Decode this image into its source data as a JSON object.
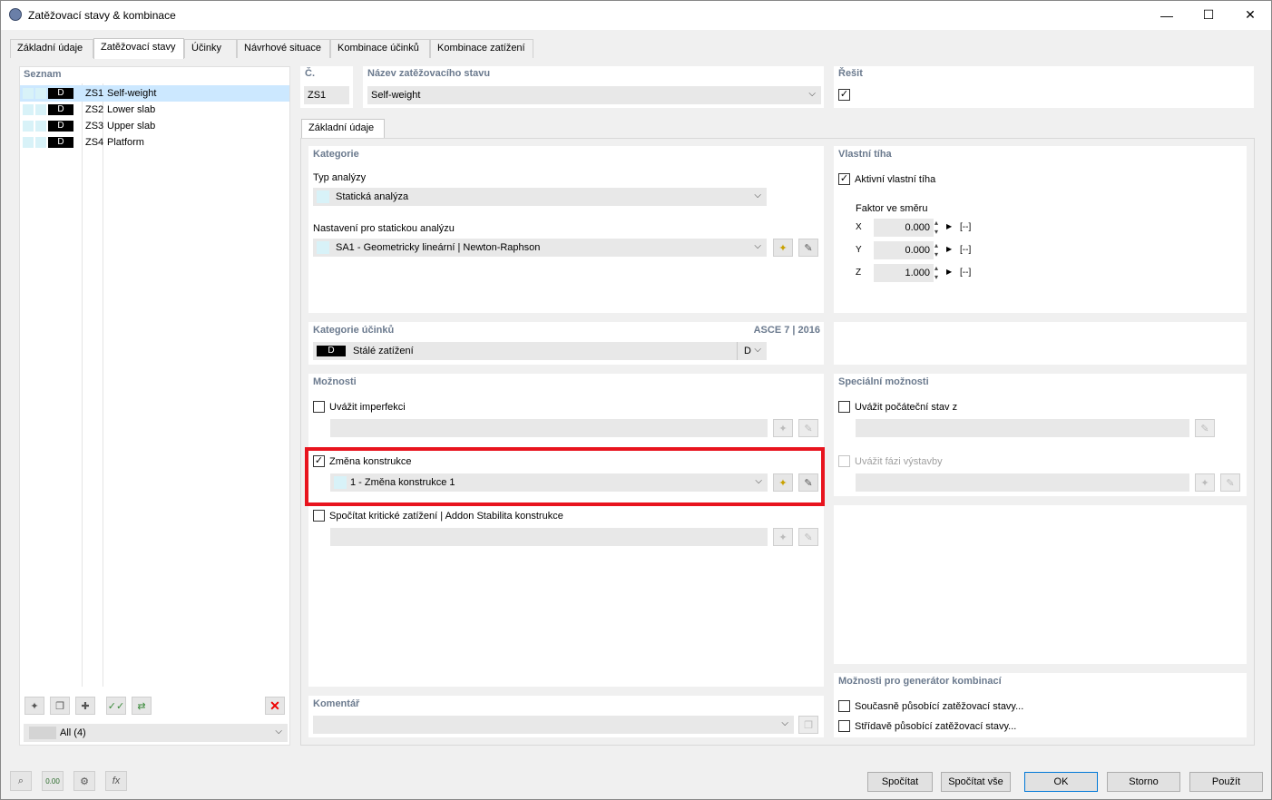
{
  "window": {
    "title": "Zatěžovací stavy & kombinace",
    "minimize": "—",
    "maximize": "☐",
    "close": "✕"
  },
  "tabs": [
    "Základní údaje",
    "Zatěžovací stavy",
    "Účinky",
    "Návrhové situace",
    "Kombinace účinků",
    "Kombinace zatížení"
  ],
  "list": {
    "title": "Seznam",
    "items": [
      {
        "type": "D",
        "id": "ZS1",
        "name": "Self-weight"
      },
      {
        "type": "D",
        "id": "ZS2",
        "name": "Lower slab"
      },
      {
        "type": "D",
        "id": "ZS3",
        "name": "Upper slab"
      },
      {
        "type": "D",
        "id": "ZS4",
        "name": "Platform"
      }
    ],
    "filter": "All (4)"
  },
  "header": {
    "no_label": "Č.",
    "no_value": "ZS1",
    "name_label": "Název zatěžovacího stavu",
    "name_value": "Self-weight",
    "solve_label": "Řešit"
  },
  "subtab": "Základní údaje",
  "category": {
    "title": "Kategorie",
    "analysis_label": "Typ analýzy",
    "analysis_value": "Statická analýza",
    "settings_label": "Nastavení pro statickou analýzu",
    "settings_value": "SA1 - Geometricky lineární | Newton-Raphson"
  },
  "selfweight": {
    "title": "Vlastní tíha",
    "active_label": "Aktivní vlastní tíha",
    "factor_label": "Faktor ve směru",
    "rows": [
      {
        "axis": "X",
        "value": "0.000",
        "unit": "[--]"
      },
      {
        "axis": "Y",
        "value": "0.000",
        "unit": "[--]"
      },
      {
        "axis": "Z",
        "value": "1.000",
        "unit": "[--]"
      }
    ]
  },
  "action": {
    "title": "Kategorie účinků",
    "code": "ASCE 7 | 2016",
    "type": "D",
    "value": "Stálé zatížení",
    "short": "D"
  },
  "options": {
    "title": "Možnosti",
    "imperfection": "Uvážit imperfekci",
    "change_label": "Změna konstrukce",
    "change_value": "1 - Změna konstrukce 1",
    "critical": "Spočítat kritické zatížení | Addon Stabilita konstrukce"
  },
  "special": {
    "title": "Speciální možnosti",
    "initial": "Uvážit počáteční stav z",
    "phase": "Uvážit fázi výstavby"
  },
  "generator": {
    "title": "Možnosti pro generátor kombinací",
    "simultaneous": "Současně působící zatěžovací stavy...",
    "alternating": "Střídavě působící zatěžovací stavy..."
  },
  "comment": {
    "title": "Komentář"
  },
  "buttons": {
    "calc": "Spočítat",
    "calc_all": "Spočítat vše",
    "ok": "OK",
    "cancel": "Storno",
    "apply": "Použít"
  },
  "colors": {
    "highlight": "#e8141e",
    "section_title": "#6b7a8e",
    "selected_row": "#cce8ff"
  }
}
